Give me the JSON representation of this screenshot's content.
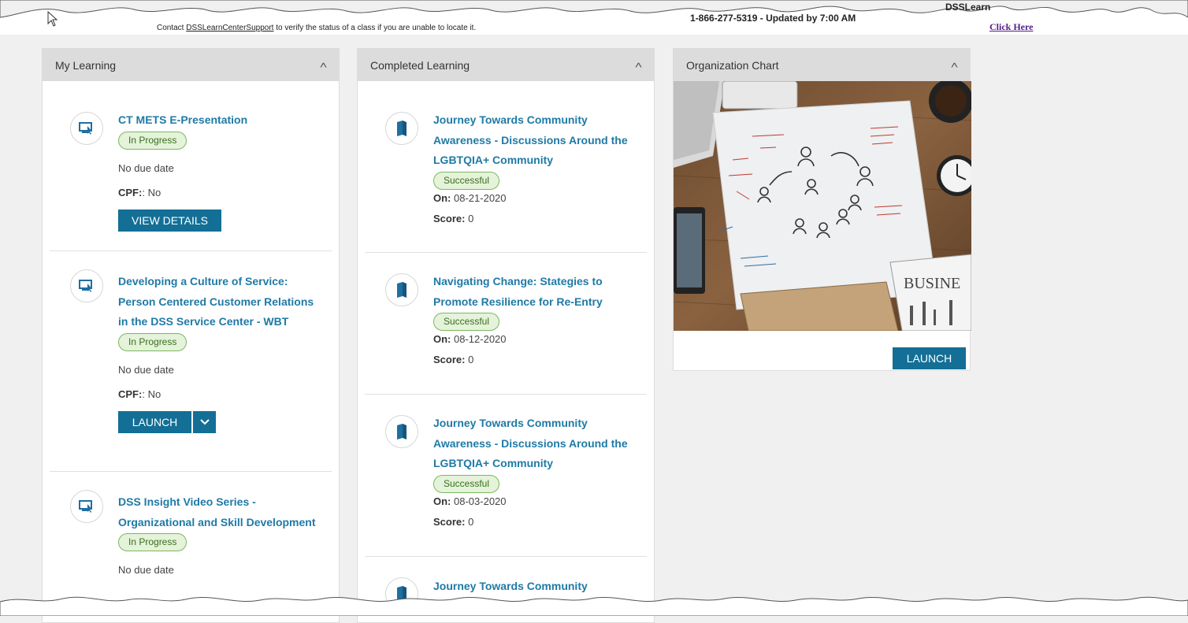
{
  "top": {
    "contact_prefix": "Contact ",
    "contact_link": "DSSLearnCenterSupport",
    "contact_suffix": " to verify the status of a class if you are unable to locate it.",
    "phone": "1-866-277-5319 - Updated by 7:00 AM",
    "dss_text": "DSSLearn",
    "click_here": "Click Here"
  },
  "my_learning": {
    "title": "My Learning",
    "items": [
      {
        "title": "CT METS E-Presentation",
        "status": "In Progress",
        "due": "No due date",
        "cpf_label": "CPF:",
        "cpf_value": ": No",
        "button": "VIEW DETAILS"
      },
      {
        "title": "Developing a Culture of Service: Person Centered Customer Relations in the DSS Service Center - WBT",
        "status": "In Progress",
        "due": "No due date",
        "cpf_label": "CPF:",
        "cpf_value": ": No",
        "button": "LAUNCH"
      },
      {
        "title": "DSS Insight Video Series - Organizational and Skill Development",
        "status": "In Progress",
        "due": "No due date"
      }
    ]
  },
  "completed_learning": {
    "title": "Completed Learning",
    "items": [
      {
        "title": "Journey Towards Community Awareness - Discussions Around the LGBTQIA+ Community",
        "status": "Successful",
        "on_label": "On:",
        "on_value": "08-21-2020",
        "score_label": "Score:",
        "score_value": "0"
      },
      {
        "title": "Navigating Change: Stategies to Promote Resilience for Re-Entry",
        "status": "Successful",
        "on_label": "On:",
        "on_value": "08-12-2020",
        "score_label": "Score:",
        "score_value": "0"
      },
      {
        "title": "Journey Towards Community Awareness - Discussions Around the LGBTQIA+ Community",
        "status": "Successful",
        "on_label": "On:",
        "on_value": "08-03-2020",
        "score_label": "Score:",
        "score_value": "0"
      },
      {
        "title": "Journey Towards Community"
      }
    ]
  },
  "org_chart": {
    "title": "Organization Chart",
    "button": "LAUNCH",
    "image_text": "BUSINE"
  },
  "icons": {
    "chevron": "chevron-up-icon",
    "course": "computer-cursor-icon",
    "book": "book-icon"
  },
  "colors": {
    "accent": "#136f96",
    "link": "#1f7aa6",
    "badge_bg": "#e4f3d9",
    "badge_border": "#7cb861"
  }
}
